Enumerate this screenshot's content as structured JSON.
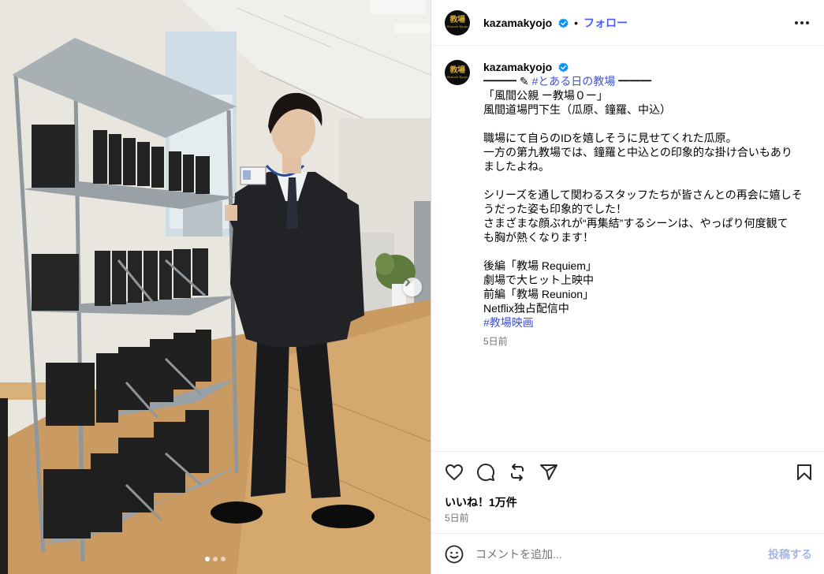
{
  "post": {
    "username": "kazamakyojo",
    "separator": "•",
    "follow_label": "フォロー",
    "avatar_text": "教場",
    "avatar_subtext": "Shinsei Kyojo",
    "caption_lines": [
      {
        "pre": "━━━ ✎ ",
        "tag": "#とある日の教場",
        "post": " ━━━"
      },
      {
        "pre": "「風間公親 ー教場０ー」",
        "tag": "",
        "post": ""
      },
      {
        "pre": "風間道場門下生（瓜原、鐘羅、中込）",
        "tag": "",
        "post": ""
      },
      {
        "pre": "",
        "tag": "",
        "post": ""
      },
      {
        "pre": "職場にて自らのIDを嬉しそうに見せてくれた瓜原。",
        "tag": "",
        "post": ""
      },
      {
        "pre": "一方の第九教場では、鐘羅と中込との印象的な掛け合いもあり",
        "tag": "",
        "post": ""
      },
      {
        "pre": "ましたよね。",
        "tag": "",
        "post": ""
      },
      {
        "pre": "",
        "tag": "",
        "post": ""
      },
      {
        "pre": "シリーズを通して関わるスタッフたちが皆さんとの再会に嬉しそ",
        "tag": "",
        "post": ""
      },
      {
        "pre": "うだった姿も印象的でした！",
        "tag": "",
        "post": ""
      },
      {
        "pre": "さまざまな顔ぶれが“再集結”するシーンは、やっぱり何度観て",
        "tag": "",
        "post": ""
      },
      {
        "pre": "も胸が熱くなります！",
        "tag": "",
        "post": ""
      },
      {
        "pre": "",
        "tag": "",
        "post": ""
      },
      {
        "pre": "後編「教場 Requiem」",
        "tag": "",
        "post": ""
      },
      {
        "pre": "劇場で大ヒット上映中",
        "tag": "",
        "post": ""
      },
      {
        "pre": "前編「教場 Reunion」",
        "tag": "",
        "post": ""
      },
      {
        "pre": "Netflix独占配信中",
        "tag": "",
        "post": ""
      },
      {
        "pre": "",
        "tag": "#教場映画",
        "post": ""
      }
    ],
    "caption_time": "5日前",
    "likes": "いいね！1万件",
    "date": "5日前",
    "comment_placeholder": "コメントを追加...",
    "post_button": "投稿する"
  },
  "icons": {
    "more": "more-icon",
    "like": "heart-icon",
    "comment": "comment-icon",
    "repost": "repost-icon",
    "share": "share-icon",
    "save": "bookmark-icon",
    "emoji": "emoji-icon",
    "next": "chevron-right-icon",
    "verified": "verified-badge-icon"
  },
  "carousel": {
    "count": 3,
    "active": 1
  },
  "colors": {
    "link": "#3f51d8",
    "follow": "#4a5df9",
    "muted": "#737373",
    "verified": "#0095f6"
  }
}
